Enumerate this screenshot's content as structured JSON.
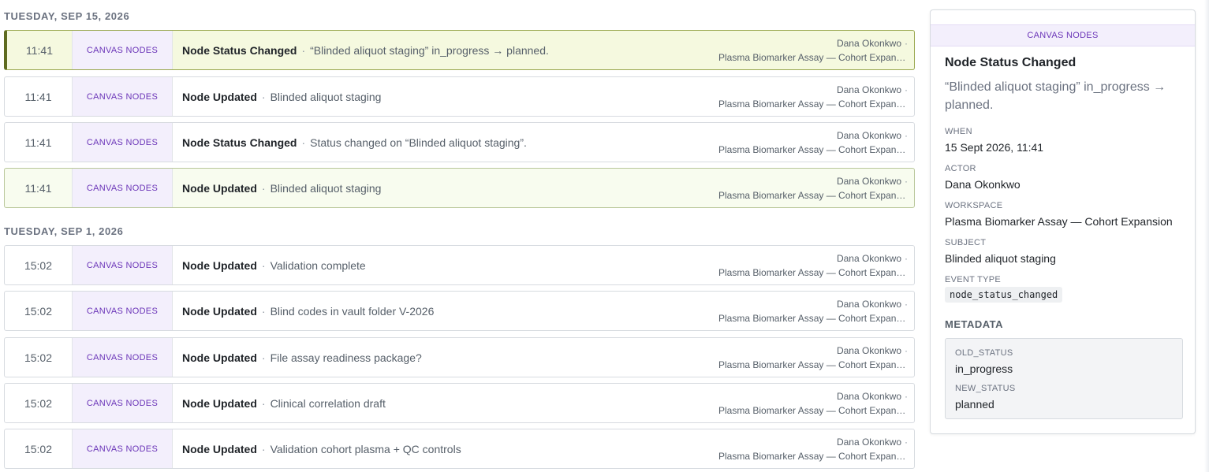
{
  "days": [
    {
      "label": "TUESDAY, SEP 15, 2026",
      "events": [
        {
          "time": "11:41",
          "category": "CANVAS NODES",
          "title": "Node Status Changed",
          "description": "“Blinded aliquot staging” in_progress → planned.",
          "actor": "Dana Okonkwo",
          "workspace": "Plasma Biomarker Assay — Cohort Expansion",
          "state": "selected"
        },
        {
          "time": "11:41",
          "category": "CANVAS NODES",
          "title": "Node Updated",
          "description": "Blinded aliquot staging",
          "actor": "Dana Okonkwo",
          "workspace": "Plasma Biomarker Assay — Cohort Expansion",
          "state": "normal"
        },
        {
          "time": "11:41",
          "category": "CANVAS NODES",
          "title": "Node Status Changed",
          "description": "Status changed on “Blinded aliquot staging”.",
          "actor": "Dana Okonkwo",
          "workspace": "Plasma Biomarker Assay — Cohort Expansion",
          "state": "normal"
        },
        {
          "time": "11:41",
          "category": "CANVAS NODES",
          "title": "Node Updated",
          "description": "Blinded aliquot staging",
          "actor": "Dana Okonkwo",
          "workspace": "Plasma Biomarker Assay — Cohort Expansion",
          "state": "highlighted"
        }
      ]
    },
    {
      "label": "TUESDAY, SEP 1, 2026",
      "events": [
        {
          "time": "15:02",
          "category": "CANVAS NODES",
          "title": "Node Updated",
          "description": "Validation complete",
          "actor": "Dana Okonkwo",
          "workspace": "Plasma Biomarker Assay — Cohort Expansion",
          "state": "normal"
        },
        {
          "time": "15:02",
          "category": "CANVAS NODES",
          "title": "Node Updated",
          "description": "Blind codes in vault folder V-2026",
          "actor": "Dana Okonkwo",
          "workspace": "Plasma Biomarker Assay — Cohort Expansion",
          "state": "normal"
        },
        {
          "time": "15:02",
          "category": "CANVAS NODES",
          "title": "Node Updated",
          "description": "File assay readiness package?",
          "actor": "Dana Okonkwo",
          "workspace": "Plasma Biomarker Assay — Cohort Expansion",
          "state": "normal"
        },
        {
          "time": "15:02",
          "category": "CANVAS NODES",
          "title": "Node Updated",
          "description": "Clinical correlation draft",
          "actor": "Dana Okonkwo",
          "workspace": "Plasma Biomarker Assay — Cohort Expansion",
          "state": "normal"
        },
        {
          "time": "15:02",
          "category": "CANVAS NODES",
          "title": "Node Updated",
          "description": "Validation cohort plasma + QC controls",
          "actor": "Dana Okonkwo",
          "workspace": "Plasma Biomarker Assay — Cohort Expansion",
          "state": "normal"
        }
      ]
    }
  ],
  "separator": "·",
  "detail": {
    "category": "CANVAS NODES",
    "title": "Node Status Changed",
    "description": "“Blinded aliquot staging” in_progress → planned.",
    "when_label": "WHEN",
    "when": "15 Sept 2026, 11:41",
    "actor_label": "ACTOR",
    "actor": "Dana Okonkwo",
    "workspace_label": "WORKSPACE",
    "workspace": "Plasma Biomarker Assay — Cohort Expansion",
    "subject_label": "SUBJECT",
    "subject": "Blinded aliquot staging",
    "event_type_label": "EVENT TYPE",
    "event_type": "node_status_changed",
    "metadata_label": "METADATA",
    "metadata": [
      {
        "key": "OLD_STATUS",
        "value": "in_progress"
      },
      {
        "key": "NEW_STATUS",
        "value": "planned"
      }
    ]
  }
}
